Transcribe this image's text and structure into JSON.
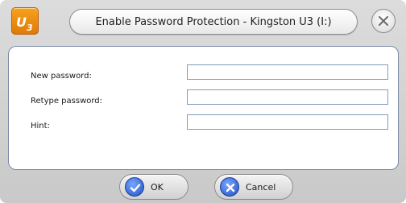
{
  "window": {
    "title": "Enable Password Protection - Kingston U3 (I:)",
    "logo_text": "U3",
    "logo_icon": "u3-logo-icon",
    "close_icon": "close-icon"
  },
  "form": {
    "fields": [
      {
        "label": "New password:",
        "value": ""
      },
      {
        "label": "Retype password:",
        "value": ""
      },
      {
        "label": "Hint:",
        "value": ""
      }
    ]
  },
  "buttons": {
    "ok": {
      "label": "OK",
      "icon": "checkmark-icon"
    },
    "cancel": {
      "label": "Cancel",
      "icon": "x-icon"
    }
  },
  "colors": {
    "logo_orange": "#f08d12",
    "button_blue": "#2a5bd7"
  }
}
